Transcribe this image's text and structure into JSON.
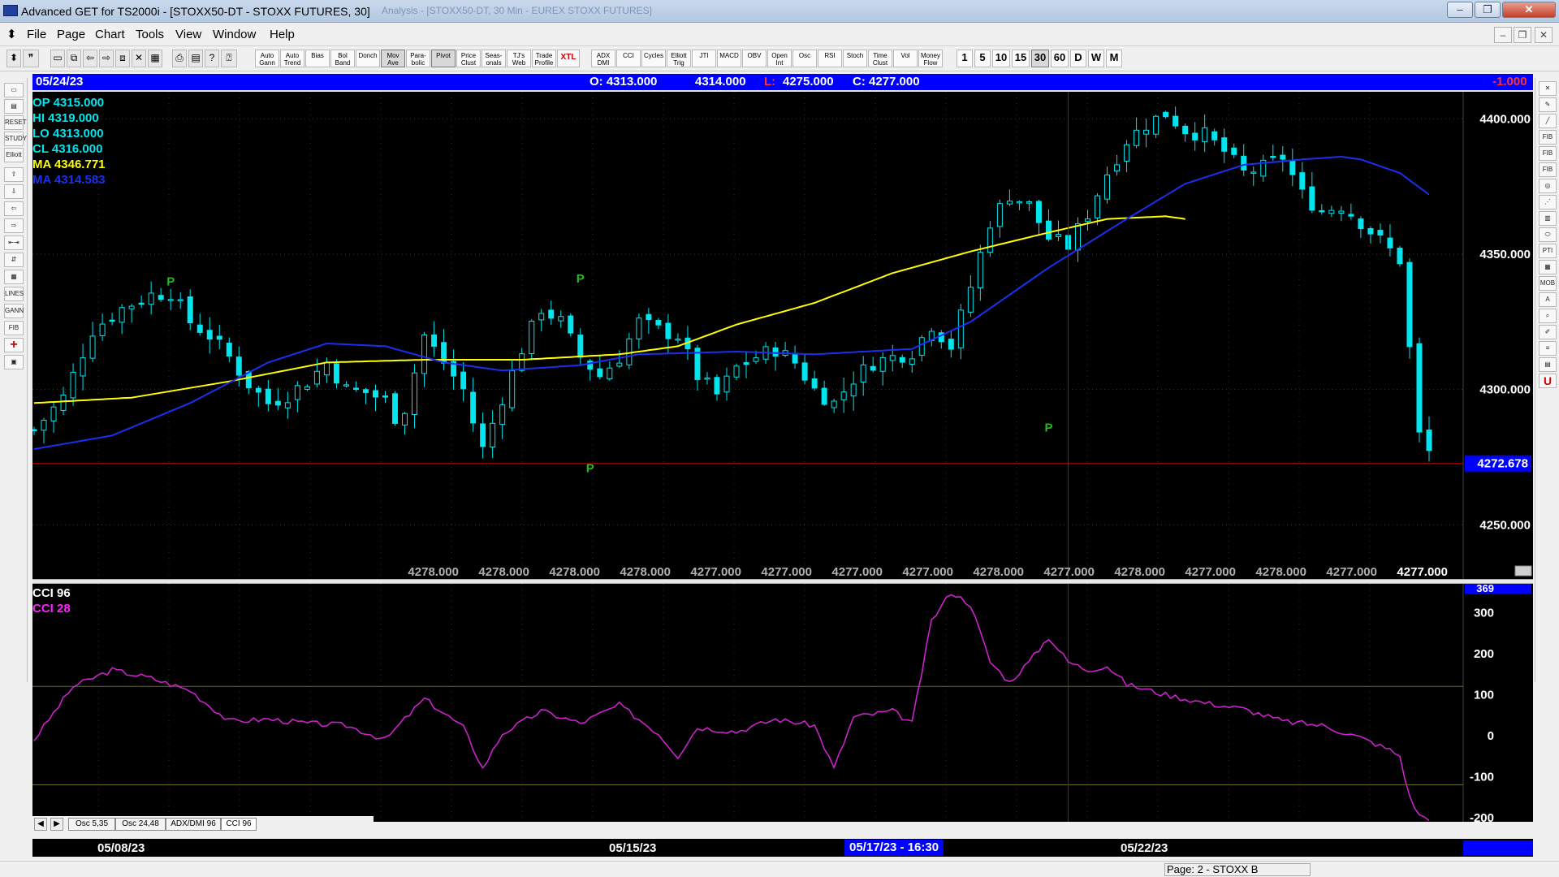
{
  "window": {
    "title": "Advanced GET for TS2000i - [STOXX50-DT - STOXX FUTURES, 30]",
    "faded_title": "Analysis - [STOXX50-DT, 30 Min - EUREX STOXX FUTURES]"
  },
  "menu": [
    "File",
    "Page",
    "Chart",
    "Tools",
    "View",
    "Window",
    "Help"
  ],
  "toolbar": {
    "studies": [
      "Auto Gann",
      "Auto Trend",
      "Bias",
      "Bol Band",
      "Donch",
      "Mov Ave",
      "Para-bolic",
      "Pivot",
      "Price Clust",
      "Seas-onals",
      "TJ's Web",
      "Trade Profile",
      "XTL",
      "ADX DMI",
      "CCI",
      "Cycles",
      "Elliott Trig",
      "JTI",
      "MACD",
      "OBV",
      "Open Int",
      "Osc",
      "RSI",
      "Stoch",
      "Time Clust",
      "Vol",
      "Money Flow"
    ],
    "intervals": [
      "1",
      "5",
      "10",
      "15",
      "30",
      "60",
      "D",
      "W",
      "M"
    ],
    "active_interval": "30"
  },
  "infobar": {
    "date": "05/24/23",
    "open": "O: 4313.000",
    "high": "4314.000",
    "low_label": "L:",
    "low": "4275.000",
    "close": "C: 4277.000",
    "change": "-1.000"
  },
  "legend": {
    "op": "OP  4315.000",
    "hi": "HI   4319.000",
    "lo": "LO  4313.000",
    "cl": "CL  4316.000",
    "ma1": "MA  4346.771",
    "ma2": "MA  4314.583"
  },
  "price_axis": {
    "labels": [
      "4400.000",
      "4350.000",
      "4300.000",
      "4250.000"
    ],
    "current": "4272.678"
  },
  "bottom_values": [
    "4278.000",
    "4278.000",
    "4278.000",
    "4278.000",
    "4277.000",
    "4277.000",
    "4277.000",
    "4277.000",
    "4278.000",
    "4277.000",
    "4278.000",
    "4277.000",
    "4278.000",
    "4277.000"
  ],
  "bottom_last": "4277.000",
  "pivot_labels": [
    "P",
    "P",
    "P",
    "P"
  ],
  "osc": {
    "label1": "CCI 96",
    "label2": "CCI  28",
    "top_value": "369",
    "axis": [
      "300",
      "200",
      "100",
      "0",
      "-100",
      "-200"
    ]
  },
  "tabs": [
    "Osc 5,35",
    "Osc 24,48",
    "ADX/DMI 96",
    "CCI 96"
  ],
  "active_tab": "CCI 96",
  "dates": {
    "d1": "05/08/23",
    "d2": "05/15/23",
    "cursor": "05/17/23 - 16:30",
    "d3": "05/22/23"
  },
  "status": {
    "page": "Page: 2 - STOXX B"
  },
  "colors": {
    "background": "#000000",
    "candles": "#00e5ee",
    "ma_yellow": "#ffff00",
    "ma_blue": "#1a2ff0",
    "cci": "#cc22cc",
    "crosshair": "#c00000",
    "pivot": "#22bb22",
    "infobar": "#0000ff"
  },
  "chart_data": {
    "type": "candlestick",
    "instrument": "STOXX50-DT - STOXX FUTURES, 30",
    "ylim": [
      4230,
      4410
    ],
    "close_path": [
      [
        0,
        4285
      ],
      [
        3,
        4297
      ],
      [
        6,
        4322
      ],
      [
        9,
        4330
      ],
      [
        12,
        4335
      ],
      [
        14,
        4336
      ],
      [
        16,
        4325
      ],
      [
        18,
        4320
      ],
      [
        20,
        4312
      ],
      [
        22,
        4302
      ],
      [
        24,
        4295
      ],
      [
        26,
        4298
      ],
      [
        28,
        4303
      ],
      [
        30,
        4310
      ],
      [
        32,
        4300
      ],
      [
        34,
        4299
      ],
      [
        36,
        4296
      ],
      [
        37,
        4290
      ],
      [
        38,
        4293
      ],
      [
        40,
        4320
      ],
      [
        42,
        4310
      ],
      [
        44,
        4300
      ],
      [
        45,
        4288
      ],
      [
        46,
        4278
      ],
      [
        48,
        4297
      ],
      [
        50,
        4315
      ],
      [
        52,
        4330
      ],
      [
        54,
        4325
      ],
      [
        56,
        4312
      ],
      [
        58,
        4305
      ],
      [
        60,
        4312
      ],
      [
        62,
        4325
      ],
      [
        64,
        4322
      ],
      [
        66,
        4320
      ],
      [
        68,
        4305
      ],
      [
        70,
        4298
      ],
      [
        72,
        4308
      ],
      [
        74,
        4312
      ],
      [
        76,
        4315
      ],
      [
        78,
        4310
      ],
      [
        80,
        4300
      ],
      [
        82,
        4295
      ],
      [
        84,
        4304
      ],
      [
        86,
        4310
      ],
      [
        88,
        4312
      ],
      [
        90,
        4314
      ],
      [
        92,
        4324
      ],
      [
        94,
        4316
      ],
      [
        96,
        4338
      ],
      [
        98,
        4362
      ],
      [
        100,
        4372
      ],
      [
        102,
        4368
      ],
      [
        104,
        4356
      ],
      [
        106,
        4353
      ],
      [
        108,
        4365
      ],
      [
        110,
        4380
      ],
      [
        112,
        4392
      ],
      [
        114,
        4398
      ],
      [
        116,
        4402
      ],
      [
        118,
        4396
      ],
      [
        120,
        4394
      ],
      [
        122,
        4388
      ],
      [
        124,
        4380
      ],
      [
        126,
        4382
      ],
      [
        128,
        4386
      ],
      [
        130,
        4372
      ],
      [
        132,
        4366
      ],
      [
        134,
        4368
      ],
      [
        136,
        4362
      ],
      [
        138,
        4355
      ],
      [
        140,
        4348
      ],
      [
        141,
        4315
      ],
      [
        142,
        4283
      ],
      [
        143,
        4277
      ]
    ],
    "cci_path": [
      [
        0,
        -10
      ],
      [
        4,
        120
      ],
      [
        8,
        160
      ],
      [
        12,
        140
      ],
      [
        16,
        110
      ],
      [
        20,
        35
      ],
      [
        24,
        40
      ],
      [
        28,
        30
      ],
      [
        32,
        25
      ],
      [
        36,
        -10
      ],
      [
        40,
        90
      ],
      [
        44,
        20
      ],
      [
        46,
        -80
      ],
      [
        48,
        5
      ],
      [
        52,
        60
      ],
      [
        56,
        30
      ],
      [
        60,
        75
      ],
      [
        64,
        5
      ],
      [
        66,
        -50
      ],
      [
        68,
        20
      ],
      [
        72,
        10
      ],
      [
        76,
        40
      ],
      [
        80,
        25
      ],
      [
        82,
        -80
      ],
      [
        84,
        45
      ],
      [
        88,
        60
      ],
      [
        90,
        30
      ],
      [
        92,
        280
      ],
      [
        94,
        350
      ],
      [
        96,
        320
      ],
      [
        98,
        180
      ],
      [
        100,
        130
      ],
      [
        102,
        180
      ],
      [
        104,
        240
      ],
      [
        106,
        180
      ],
      [
        108,
        160
      ],
      [
        110,
        170
      ],
      [
        112,
        125
      ],
      [
        116,
        100
      ],
      [
        120,
        80
      ],
      [
        124,
        65
      ],
      [
        128,
        35
      ],
      [
        132,
        25
      ],
      [
        136,
        -5
      ],
      [
        139,
        -35
      ],
      [
        140,
        -50
      ],
      [
        141,
        -150
      ],
      [
        142,
        -195
      ],
      [
        143,
        -200
      ]
    ],
    "series": [
      {
        "name": "MA 4346.771",
        "type": "line",
        "color": "#ffff00",
        "points": [
          [
            0,
            4295
          ],
          [
            10,
            4297
          ],
          [
            20,
            4303
          ],
          [
            30,
            4310
          ],
          [
            40,
            4311
          ],
          [
            50,
            4311
          ],
          [
            60,
            4313
          ],
          [
            66,
            4316
          ],
          [
            72,
            4324
          ],
          [
            80,
            4332
          ],
          [
            88,
            4343
          ],
          [
            96,
            4351
          ],
          [
            104,
            4358
          ],
          [
            110,
            4363
          ],
          [
            116,
            4364
          ],
          [
            118,
            4363
          ]
        ]
      },
      {
        "name": "MA 4314.583",
        "type": "line",
        "color": "#1a2ff0",
        "points": [
          [
            0,
            4278
          ],
          [
            8,
            4283
          ],
          [
            16,
            4295
          ],
          [
            24,
            4310
          ],
          [
            30,
            4317
          ],
          [
            36,
            4316
          ],
          [
            42,
            4310
          ],
          [
            48,
            4307
          ],
          [
            56,
            4309
          ],
          [
            62,
            4313
          ],
          [
            72,
            4314
          ],
          [
            80,
            4313
          ],
          [
            90,
            4315
          ],
          [
            96,
            4325
          ],
          [
            104,
            4345
          ],
          [
            112,
            4363
          ],
          [
            118,
            4376
          ],
          [
            124,
            4383
          ],
          [
            130,
            4385
          ],
          [
            134,
            4386
          ],
          [
            136,
            4385
          ],
          [
            140,
            4380
          ],
          [
            143,
            4372
          ]
        ]
      },
      {
        "name": "CCI 96",
        "type": "line",
        "color": "#cc22cc"
      }
    ],
    "bar_count": 144,
    "pivots": [
      [
        14,
        4340,
        "P"
      ],
      [
        56,
        4341,
        "P"
      ],
      [
        57,
        4271,
        "P"
      ],
      [
        104,
        4286,
        "P"
      ]
    ],
    "crosshair": {
      "x": 106,
      "y": 4272.678
    },
    "osc_ylim": [
      -210,
      370
    ],
    "osc_levels": [
      120,
      -120
    ],
    "xlabel": "",
    "ylabel": ""
  }
}
